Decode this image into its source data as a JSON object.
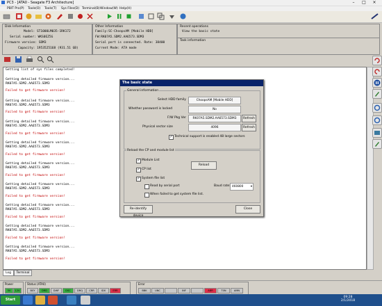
{
  "window": {
    "title": "PC3 - [ATA0 - Seagate F3 Architecture]"
  },
  "menu": [
    "PBIT Pro(P)",
    "Tools(O)",
    "Tools(T)",
    "Sys Files(D)",
    "Terminal(B)",
    "Window(W)",
    "Help(H)"
  ],
  "disk_info": {
    "title": "Disk Information",
    "model": "Model: ST1000LM035-1RK172",
    "serial": "Serial number: WKS0EZ5G",
    "firmware": "Firmware version: SDM3",
    "capacity": "Capacity: 1953525168 (931.51 GB)"
  },
  "other_info": {
    "title": "Other Information",
    "family": "Family:SC-ChoopsAM [Mobile HDD]",
    "fw": "FW:RK07A5.SDM2.AA6573.SDM3",
    "serial_port": "Serial port is connected. Rate: 38400",
    "mode": "Current Mode: ATA mode"
  },
  "recent_ops": {
    "title": "Recent operations",
    "item": "View the basic state"
  },
  "task_info": {
    "title": "Task information"
  },
  "log_lines": [
    {
      "text": "Getting list of sys files completed!",
      "fail": false
    },
    {
      "text": "Getting detailed firmware version...",
      "fail": false
    },
    {
      "text": "RK07A5.SDM2.AA6573.SDM3",
      "fail": false
    },
    {
      "text": "Failed to get firmware version!",
      "fail": true
    },
    {
      "text": "Getting detailed firmware version...",
      "fail": false
    },
    {
      "text": "RK07A5.SDM2.AA6573.SDM3",
      "fail": false
    },
    {
      "text": "Failed to get firmware version!",
      "fail": true
    },
    {
      "text": "Getting detailed firmware version...",
      "fail": false
    },
    {
      "text": "RK07A5.SDM2.AA6573.SDM3",
      "fail": false
    },
    {
      "text": "Failed to get firmware version!",
      "fail": true
    },
    {
      "text": "Getting detailed firmware version...",
      "fail": false
    },
    {
      "text": "RK07A5.SDM2.AA6573.SDM3",
      "fail": false
    },
    {
      "text": "Failed to get firmware version!",
      "fail": true
    },
    {
      "text": "Getting detailed firmware version...",
      "fail": false
    },
    {
      "text": "RK07A5.SDM2.AA6573.SDM3",
      "fail": false
    },
    {
      "text": "Failed to get firmware version!",
      "fail": true
    },
    {
      "text": "Getting detailed firmware version...",
      "fail": false
    },
    {
      "text": "RK07A5.SDM2.AA6573.SDM3",
      "fail": false
    },
    {
      "text": "Failed to get firmware version!",
      "fail": true
    },
    {
      "text": "Getting detailed firmware version...",
      "fail": false
    },
    {
      "text": "RK07A5.SDM2.AA6573.SDM3",
      "fail": false
    },
    {
      "text": "Failed to get firmware version!",
      "fail": true
    },
    {
      "text": "Getting detailed firmware version...",
      "fail": false
    },
    {
      "text": "RK07A5.SDM2.AA6573.SDM3",
      "fail": false
    },
    {
      "text": "Failed to get firmware version!",
      "fail": true
    },
    {
      "text": "Getting detailed firmware version...",
      "fail": false
    },
    {
      "text": "RK07A5.SDM2.AA6573.SDM3",
      "fail": false
    },
    {
      "text": "Failed to get firmware version!",
      "fail": true
    }
  ],
  "tabs": [
    "Log",
    "Terminal"
  ],
  "status": {
    "power_title": "Power",
    "power_lamps": [
      "5V",
      "12V"
    ],
    "status_title": "Status (ATA0)",
    "status_lamps": [
      "BSY",
      "DRD",
      "DWF",
      "DSC",
      "DRQ",
      "CRR",
      "IDX",
      "ERR"
    ],
    "error_title": "Error",
    "error_lamps": [
      "BBK",
      "UNC",
      "",
      "INF",
      "",
      "ABR",
      "T0N",
      "AMN"
    ]
  },
  "dialog": {
    "title": "The basic state",
    "general_legend": "General information",
    "family_label": "Select HDD family",
    "family_value": "ChoopsAM [Mobile HDD]",
    "password_label": "Whether password is locked",
    "password_value": "No",
    "fw_label": "F/W Pkg Ver",
    "fw_value": "RK07A5.SDM2.AA6573.SDM3",
    "sector_label": "Physical sector size",
    "sector_value": "4096",
    "refresh_label": "Refresh",
    "tech_support": "Technical support is enabled 48 large sectors",
    "reload_legend": "Reload the CP and module list",
    "module_list": "Module List",
    "cp_list": "CP list",
    "sys_file_list": "System file list",
    "reload_btn": "Reload",
    "read_serial": "Read by serial port",
    "baud_label": "Baud rate:",
    "baud_value": "460800",
    "when_failed": "When failed to get system file list.",
    "reidentify_btn": "Re-identify device",
    "close_btn": "Close"
  },
  "taskbar": {
    "start": "Start",
    "time": "09:28",
    "date": "2/1/2018"
  }
}
